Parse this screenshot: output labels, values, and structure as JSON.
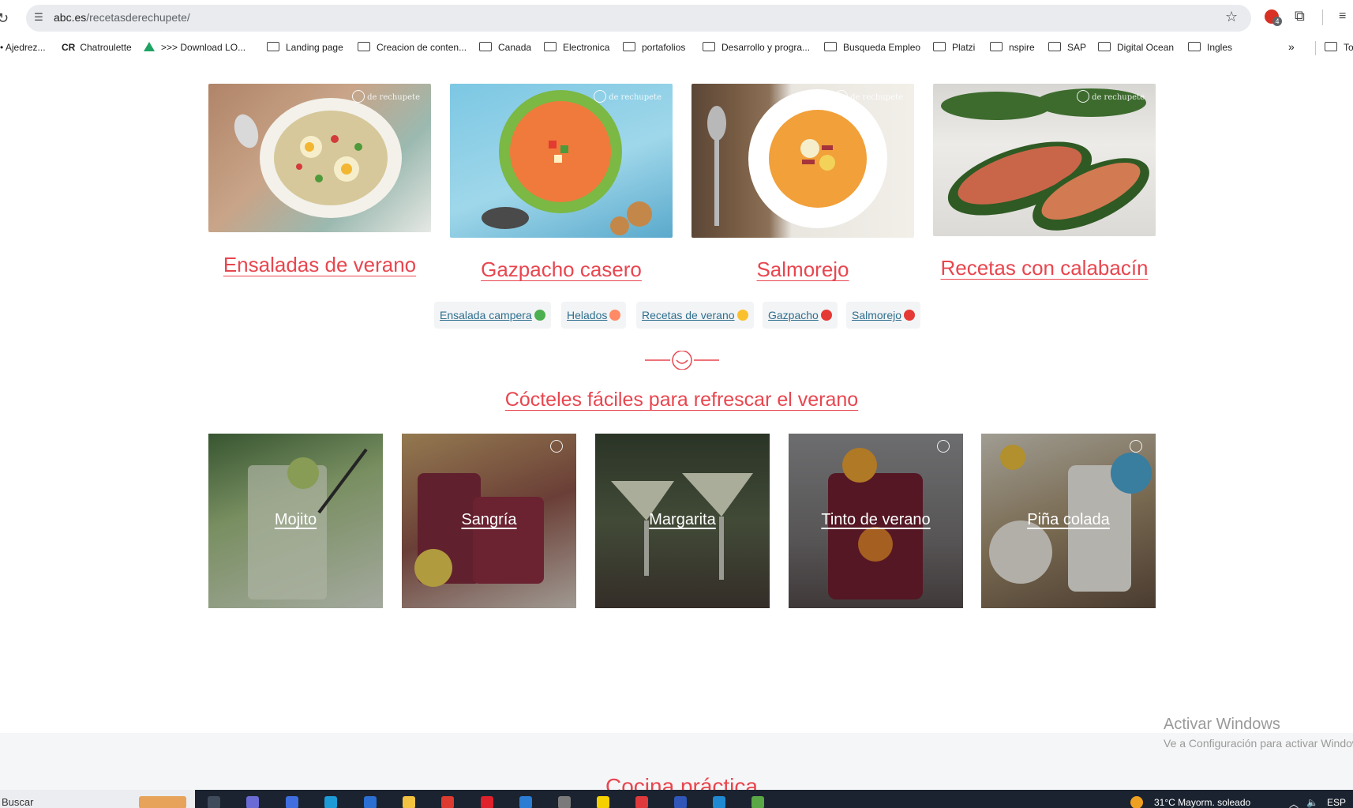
{
  "browser": {
    "url_host": "abc.es",
    "url_path": "/recetasderechupete/",
    "extension_badge": "4"
  },
  "bookmarks": [
    {
      "label": "• Ajedrez...",
      "kind": "text"
    },
    {
      "label": "Chatroulette",
      "kind": "cr",
      "prefix": "CR"
    },
    {
      "label": ">>> Download LO...",
      "kind": "drive"
    },
    {
      "label": "Landing page",
      "kind": "folder"
    },
    {
      "label": "Creacion de conten...",
      "kind": "folder"
    },
    {
      "label": "Canada",
      "kind": "folder"
    },
    {
      "label": "Electronica",
      "kind": "folder"
    },
    {
      "label": "portafolios",
      "kind": "folder"
    },
    {
      "label": "Desarrollo y progra...",
      "kind": "folder"
    },
    {
      "label": "Busqueda Empleo",
      "kind": "folder"
    },
    {
      "label": "Platzi",
      "kind": "folder"
    },
    {
      "label": "nspire",
      "kind": "folder"
    },
    {
      "label": "SAP",
      "kind": "folder"
    },
    {
      "label": "Digital Ocean",
      "kind": "folder"
    },
    {
      "label": "Ingles",
      "kind": "folder"
    },
    {
      "label": "To",
      "kind": "folder"
    }
  ],
  "recipes": [
    {
      "title": "Ensaladas de verano"
    },
    {
      "title": "Gazpacho casero"
    },
    {
      "title": "Salmorejo"
    },
    {
      "title": "Recetas con calabacín"
    }
  ],
  "tags": [
    {
      "label": "Ensalada campera",
      "emoji_color": "#4caf50"
    },
    {
      "label": "Helados",
      "emoji_color": "#ff8a65"
    },
    {
      "label": "Recetas de verano",
      "emoji_color": "#fbc02d"
    },
    {
      "label": "Gazpacho",
      "emoji_color": "#e53935"
    },
    {
      "label": "Salmorejo",
      "emoji_color": "#e53935"
    }
  ],
  "cocktails_section": {
    "title": "Cócteles fáciles para refrescar el verano",
    "items": [
      {
        "label": "Mojito"
      },
      {
        "label": "Sangría"
      },
      {
        "label": "Margarita"
      },
      {
        "label": "Tinto de verano"
      },
      {
        "label": "Piña colada"
      }
    ]
  },
  "watermark": {
    "text": "de rechupete"
  },
  "next_section": {
    "title": "Cocina práctica"
  },
  "windows_activation": {
    "title": "Activar Windows",
    "subtitle": "Ve a Configuración para activar Windows."
  },
  "taskbar": {
    "search_label": "Buscar",
    "weather": "31°C  Mayorm. soleado",
    "language": "ESP"
  },
  "colors": {
    "accent": "#e8464f",
    "tag_link": "#2f6f8f",
    "taskbar": "#1b2330"
  }
}
